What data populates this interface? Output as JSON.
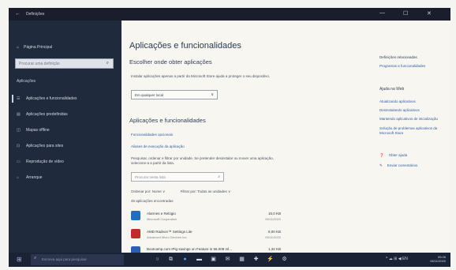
{
  "window": {
    "title": "Definições",
    "back_glyph": "←",
    "minimize_glyph": "—",
    "maximize_glyph": "☐",
    "close_glyph": "✕"
  },
  "sidebar": {
    "home_label": "Página Principal",
    "search_placeholder": "Procurar uma definição",
    "section": "Aplicações",
    "items": [
      {
        "label": "Aplicações e funcionalidades",
        "icon": "apps-list-icon",
        "glyph": "☰",
        "active": true
      },
      {
        "label": "Aplicações predefinidas",
        "icon": "default-apps-icon",
        "glyph": "▤"
      },
      {
        "label": "Mapas offline",
        "icon": "map-icon",
        "glyph": "◫"
      },
      {
        "label": "Aplicações para sites",
        "icon": "website-icon",
        "glyph": "⊡"
      },
      {
        "label": "Reprodução de vídeo",
        "icon": "video-icon",
        "glyph": "▭"
      },
      {
        "label": "Arranque",
        "icon": "startup-icon",
        "glyph": "⌂"
      }
    ]
  },
  "main": {
    "title": "Aplicações e funcionalidades",
    "source_heading": "Escolher onde obter aplicações",
    "source_desc": "Instalar aplicações apenas a partir da Microsoft Store ajuda a proteger o seu dispositivo.",
    "source_value": "Em qualquer local",
    "apps_heading": "Aplicações e funcionalidades",
    "optional_link": "Funcionalidades opcionais",
    "alias_link": "Aliases de execução da aplicação",
    "search_desc": "Pesquisar, ordenar e filtrar por unidade. Se pretender desinstalar ou mover uma aplicação, selecione-a a partir da lista.",
    "search_placeholder": "Procurar nesta lista",
    "sort_label": "Ordenar por: Nome ∨",
    "filter_label": "Filtrar por: Todas as unidades ∨",
    "count_text": "45 aplicações encontradas",
    "apps": [
      {
        "name": "Alarmes e Relógio",
        "publisher": "Microsoft Corporation",
        "size": "16,0 KB",
        "date": "06/11/2020",
        "color": "#1e6fc4"
      },
      {
        "name": "AMD Radeon™ Settings Lite",
        "publisher": "Advanced Micro Devices Inc.",
        "size": "8,00 KB",
        "date": "05/11/2020",
        "color": "#c42a2a"
      },
      {
        "name": "Bootcamp.com IPig savings on Feature in 56.008 ml...",
        "publisher": "",
        "size": "1,32 KB",
        "date": "",
        "color": "#2a5fb8"
      }
    ]
  },
  "right": {
    "related_heading": "Definições relacionadas",
    "related_link": "Programas e funcionalidades",
    "web_heading": "Ajuda na Web",
    "web_links": [
      "Atualizando aplicativos",
      "Desinstalando aplicativos",
      "Mantendo aplicativos de inicialização",
      "Solução de problemas aplicativos da Microsoft Store"
    ],
    "help_link": "Obter ajuda",
    "feedback_link": "Enviar comentários"
  },
  "taskbar": {
    "search_placeholder": "Escreva aqui para pesquisar",
    "time": "09:26",
    "date": "06/11/2020",
    "tray_text": "^ ☁ ⊞ ◀ EN"
  }
}
